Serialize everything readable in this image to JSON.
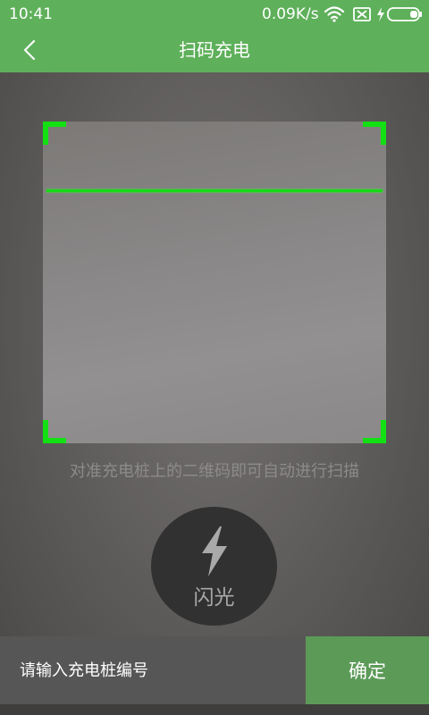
{
  "status_bar": {
    "time": "10:41",
    "net_speed": "0.09K/s",
    "icons": [
      "wifi-icon",
      "no-sim-icon",
      "charging-icon",
      "battery-icon"
    ]
  },
  "header": {
    "back_icon": "back-chevron-icon",
    "title": "扫码充电"
  },
  "scanner": {
    "hint": "对准充电桩上的二维码即可自动进行扫描",
    "frame_color": "#13e013"
  },
  "flash": {
    "icon": "lightning-icon",
    "label": "闪光"
  },
  "input_bar": {
    "placeholder": "请输入充电桩编号",
    "value": "",
    "confirm_label": "确定"
  },
  "colors": {
    "accent": "#5eb05a",
    "confirm": "#5c9a58"
  }
}
